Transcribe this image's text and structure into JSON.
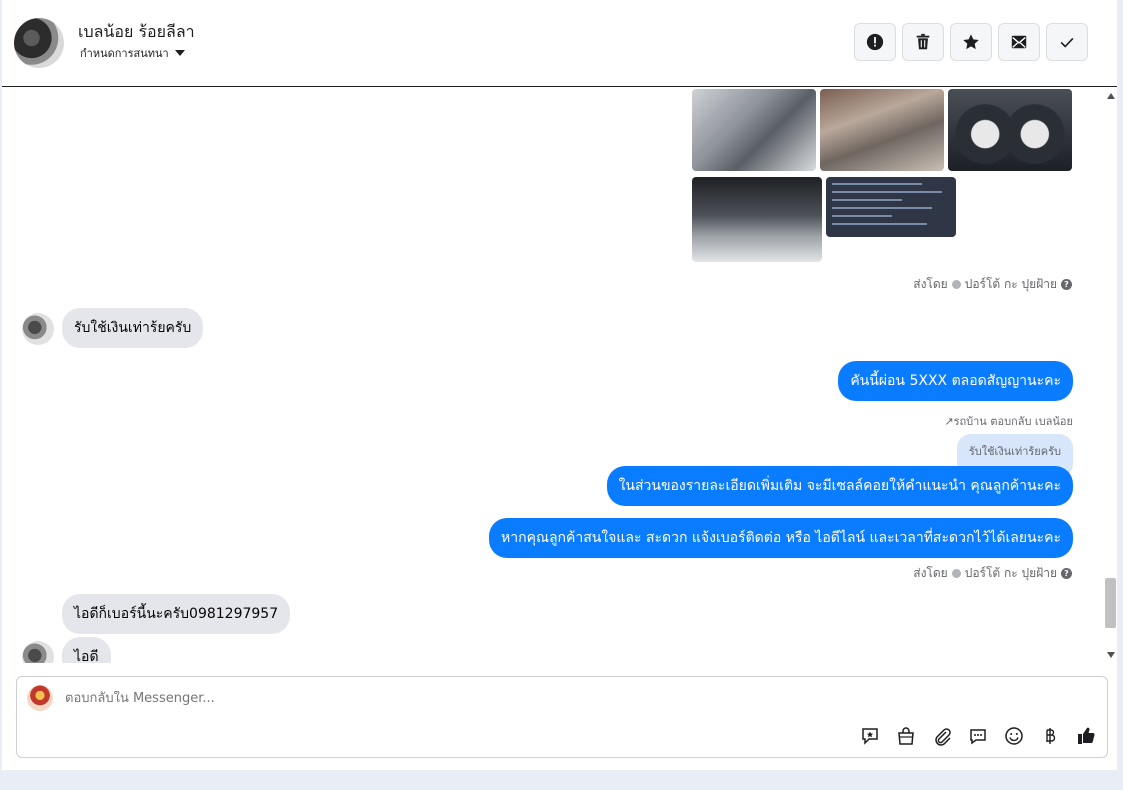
{
  "header": {
    "contact_name": "เบลน้อย ร้อยลีลา",
    "assign_label": "กำหนดการสนทนา"
  },
  "toolbar": {
    "buttons": [
      "alert-icon",
      "trash-icon",
      "star-icon",
      "mark-unread-icon",
      "check-icon"
    ]
  },
  "thread": {
    "sent_by_1": "ส่งโดย",
    "sender_name_1": "ปอร์โต้ กะ ปุยฝ้าย",
    "incoming_1": "รับใช้เงินเท่าร้ยครับ",
    "outgoing_1": "คันนี้ผ่อน 5XXX ตลอดสัญญานะคะ",
    "reply_note": "รถบ้าน ตอบกลับ เบลน้อย",
    "quoted_text": "รับใช้เงินเท่าร้ยครับ",
    "outgoing_2": "ในส่วนของรายละเอียดเพิ่มเติม จะมีเซลล์คอยให้คำแนะนำ คุณลูกค้านะคะ",
    "outgoing_3": "หากคุณลูกค้าสนใจและ สะดวก แจ้งเบอร์ติดต่อ หรือ ไอดีไลน์ และเวลาที่สะดวกไว้ได้เลยนะคะ",
    "sent_by_2": "ส่งโดย",
    "sender_name_2": "ปอร์โต้ กะ ปุยฝ้าย",
    "incoming_2": "ไอดีก็เบอร์นี้นะครับ0981297957",
    "incoming_3": "ไอดี"
  },
  "composer": {
    "placeholder": "ตอบกลับใน Messenger..."
  },
  "colors": {
    "outgoing_bubble": "#0a7cff",
    "incoming_bubble": "#e4e6eb"
  }
}
